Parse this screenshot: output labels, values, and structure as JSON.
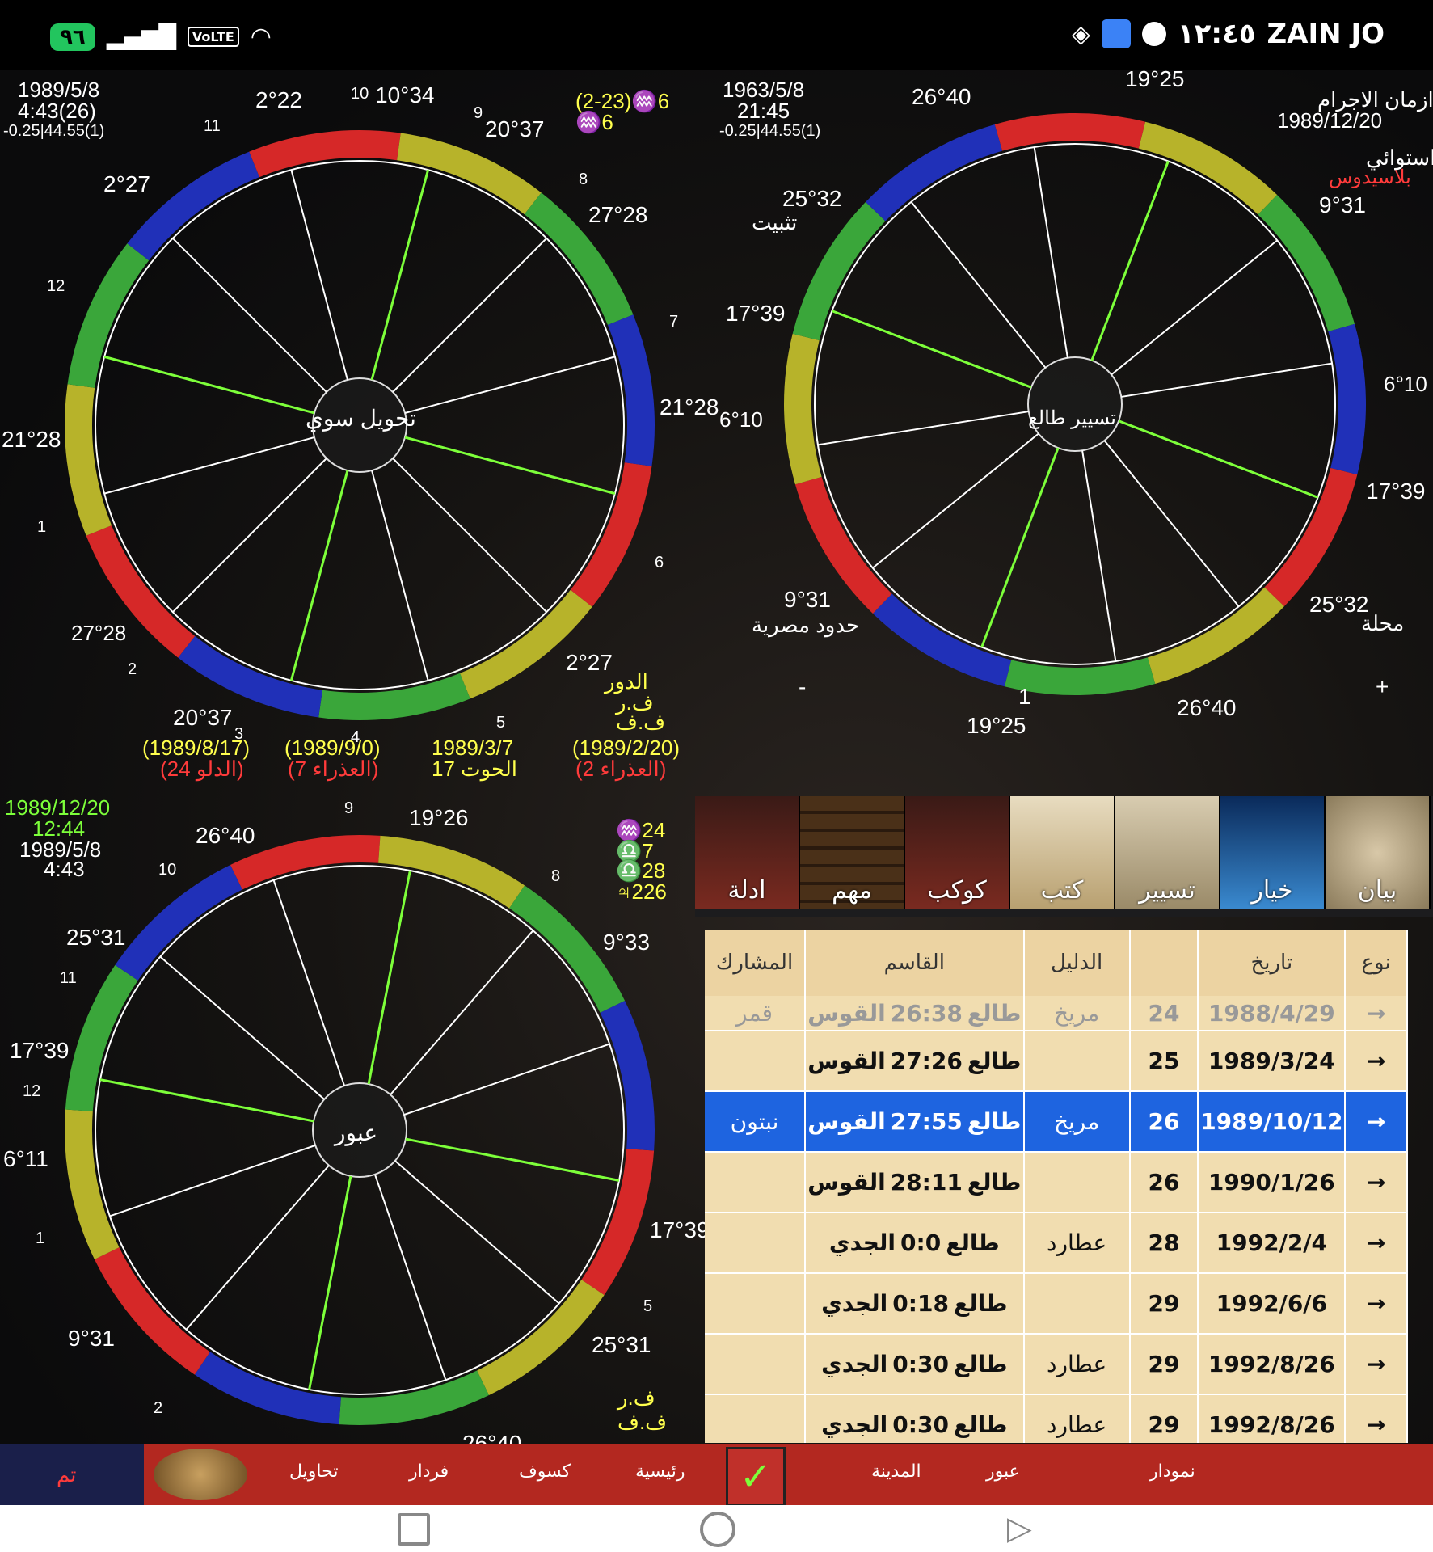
{
  "status_bar": {
    "battery": "٩٦",
    "volte": "VoLTE",
    "time": "١٢:٤٥",
    "carrier": "ZAIN JO"
  },
  "chart_tl": {
    "date": "1989/5/8",
    "time": "4:43(26)",
    "coords": "-0.25|44.55(1)",
    "center": "تحويل سوي",
    "labels": [
      "2°22",
      "10",
      "10°34",
      "9",
      "20°37",
      "11",
      "2°27",
      "8",
      "27°28",
      "12",
      "7",
      "21°28",
      "21°28",
      "1",
      "6",
      "27°28",
      "2",
      "20°37",
      "3",
      "4",
      "2°27",
      "5",
      "(2-23)♒6",
      "♒6"
    ],
    "footer": [
      "(1989/8/17)",
      "(24 الدلو)",
      "(1989/9/0)",
      "(7 العذراء)",
      "1989/3/7",
      "الحوت 17",
      "(1989/2/20)",
      "(2 العذراء)"
    ],
    "side": [
      "الدور",
      "ف.ر",
      "ف.ف"
    ]
  },
  "chart_tr": {
    "date": "1963/5/8",
    "time": "21:45",
    "coords": "-0.25|44.55(1)",
    "title": "ازمان الاجرام",
    "title_date": "1989/12/20",
    "system": "استوائي",
    "house_system": "بلاسيدوس",
    "center": "تسيير طالع",
    "labels": [
      "26°40",
      "19°25",
      "9°31",
      "25°32",
      "تثبيت",
      "17°39",
      "6°10",
      "6°10",
      "17°39",
      "9°31",
      "حدود مصرية",
      "25°32",
      "محلة",
      "19°25",
      "26°40",
      "-",
      "+",
      "1"
    ]
  },
  "chart_bl": {
    "date": "1989/12/20",
    "time": "12:44",
    "date2": "1989/5/8",
    "time2": "4:43",
    "center": "عبور",
    "labels": [
      "26°40",
      "19°26",
      "9",
      "10",
      "8",
      "25°31",
      "11",
      "9°33",
      "17°39",
      "12",
      "6°11",
      "1",
      "17°39",
      "9°31",
      "25°31",
      "2",
      "5",
      "26°40"
    ],
    "side": [
      "♒24",
      "♎7",
      "♎28",
      "♃226",
      "ف.ر",
      "ف.ف"
    ]
  },
  "thumbs": [
    {
      "label": "ادلة"
    },
    {
      "label": "مهم"
    },
    {
      "label": "كوكب"
    },
    {
      "label": "كتب"
    },
    {
      "label": "تسيير",
      "selected": true
    },
    {
      "label": "خيار"
    },
    {
      "label": "بيان"
    }
  ],
  "table": {
    "headers": [
      "المشارك",
      "القاسم",
      "الدليل",
      "",
      "تاريخ",
      "نوع"
    ],
    "rows": [
      {
        "part": "قمر",
        "divisor_sign": "القوس",
        "divisor_deg": "26:38",
        "divisor_prefix": "طالع",
        "guide": "مريخ",
        "age": "24",
        "date": "1988/4/29",
        "type": "→",
        "fade": true
      },
      {
        "part": "",
        "divisor_sign": "القوس",
        "divisor_deg": "27:26",
        "divisor_prefix": "طالع",
        "guide": "",
        "age": "25",
        "date": "1989/3/24",
        "type": "→"
      },
      {
        "part": "نبتون",
        "divisor_sign": "القوس",
        "divisor_deg": "27:55",
        "divisor_prefix": "طالع",
        "guide": "مريخ",
        "age": "26",
        "date": "1989/10/12",
        "type": "→",
        "selected": true
      },
      {
        "part": "",
        "divisor_sign": "القوس",
        "divisor_deg": "28:11",
        "divisor_prefix": "طالع",
        "guide": "",
        "age": "26",
        "date": "1990/1/26",
        "type": "→"
      },
      {
        "part": "",
        "divisor_sign": "الجدي",
        "divisor_deg": "0:0",
        "divisor_prefix": "طالع",
        "guide": "عطارد",
        "age": "28",
        "date": "1992/2/4",
        "type": "→"
      },
      {
        "part": "",
        "divisor_sign": "الجدي",
        "divisor_deg": "0:18",
        "divisor_prefix": "طالع",
        "guide": "",
        "age": "29",
        "date": "1992/6/6",
        "type": "→"
      },
      {
        "part": "",
        "divisor_sign": "الجدي",
        "divisor_deg": "0:30",
        "divisor_prefix": "طالع",
        "guide": "عطارد",
        "age": "29",
        "date": "1992/8/26",
        "type": "→"
      },
      {
        "part": "",
        "divisor_sign": "الجدي",
        "divisor_deg": "0:30",
        "divisor_prefix": "طالع",
        "guide": "عطارد",
        "age": "29",
        "date": "1992/8/26",
        "type": "→"
      }
    ]
  },
  "bottom_bar": [
    "تم",
    "تحاويل",
    "فردار",
    "كسوف",
    "رئيسية",
    "المدينة",
    "عبور",
    "نمودار"
  ],
  "colors": {
    "table_bg": "#f1ddb0",
    "selected": "#1e64e0",
    "bottom": "#b32820"
  }
}
